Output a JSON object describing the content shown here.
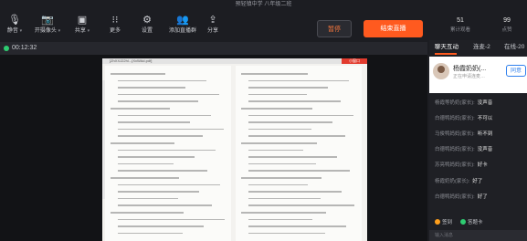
{
  "window": {
    "title": "预轻镇中学 八年级二班"
  },
  "toolbar": {
    "items": [
      {
        "label": "静音",
        "icon": "microphone-icon",
        "dropdown": true
      },
      {
        "label": "开摄像头",
        "icon": "camera-icon",
        "dropdown": true
      },
      {
        "label": "共享",
        "icon": "share-screen-icon",
        "dropdown": true
      },
      {
        "label": "更多",
        "icon": "more-icon"
      },
      {
        "label": "设置",
        "icon": "gear-icon"
      },
      {
        "label": "添加直播群",
        "icon": "add-group-icon"
      },
      {
        "label": "分享",
        "icon": "share-icon"
      }
    ],
    "pause_label": "暂停",
    "end_label": "结束直播",
    "stats": [
      {
        "value": "51",
        "label": "累计观看"
      },
      {
        "value": "99",
        "label": "点赞"
      }
    ]
  },
  "status": {
    "timer": "00:12:32"
  },
  "document": {
    "tab_text": "[ZhXXJ22hl...(XxWAd.pdf]",
    "red_label": "小窗口"
  },
  "chat": {
    "tabs": [
      "聊天互动",
      "连麦-2",
      "在线-20"
    ],
    "active_tab": 0,
    "pinned": {
      "name": "杨霞奶奶(...",
      "subtitle": "正在申请连麦…",
      "button": "同意"
    },
    "messages": [
      {
        "user": "杨霞等奶奶(家长):",
        "text": "没声音"
      },
      {
        "user": "白德鸭妈妈(家长):",
        "text": "不可以"
      },
      {
        "user": "马俊鸭妈妈(家长):",
        "text": "听不到"
      },
      {
        "user": "白德鸭妈妈(家长):",
        "text": "没声音"
      },
      {
        "user": "苏亮鸭妈妈(家长):",
        "text": "好卡"
      },
      {
        "user": "杨霞奶奶(家长):",
        "text": "好了"
      },
      {
        "user": "白德鸭妈妈(家长):",
        "text": "好了"
      }
    ],
    "bottom_pills": [
      {
        "label": "签到",
        "color": "#ff9f1c"
      },
      {
        "label": "答题卡",
        "color": "#2ecc71"
      }
    ],
    "input_placeholder": "输入消息"
  },
  "colors": {
    "accent": "#ff5a1f",
    "bg": "#1c1d22",
    "panel": "#1f2025"
  }
}
